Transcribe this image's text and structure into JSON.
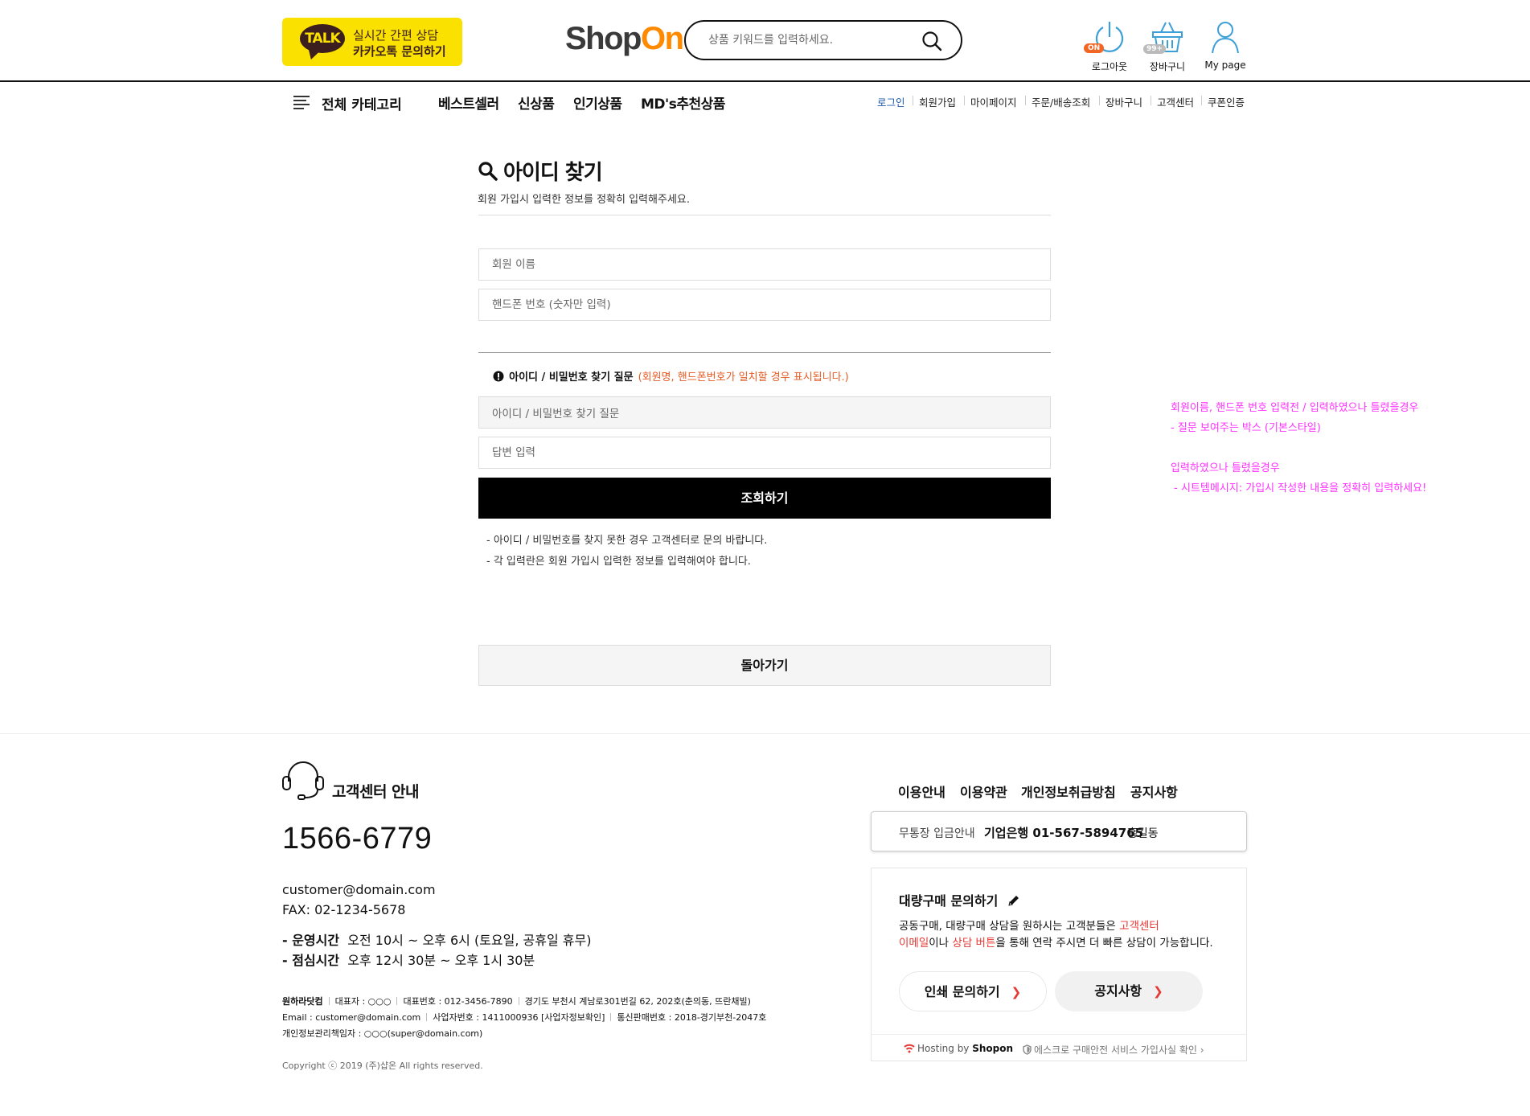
{
  "header": {
    "kakao": {
      "badge": "TALK",
      "line1": "실시간 간편 상담",
      "line2": "카카오톡 문의하기"
    },
    "logo": {
      "part1": "Shop",
      "part2": "On"
    },
    "search": {
      "placeholder": "상품 키워드를 입력하세요."
    },
    "icons": [
      {
        "label": "로그아웃",
        "badge": "ON"
      },
      {
        "label": "장바구니",
        "badge": "99+"
      },
      {
        "label": "My page"
      }
    ]
  },
  "nav": {
    "all_categories": "전체 카테고리",
    "main": [
      "베스트셀러",
      "신상품",
      "인기상품",
      "MD's추천상품"
    ],
    "util": [
      "로그인",
      "회원가입",
      "마이페이지",
      "주문/배송조회",
      "장바구니",
      "고객센터",
      "쿠폰인증"
    ]
  },
  "main": {
    "title": "아이디 찾기",
    "subtitle": "회원 가입시 입력한 정보를 정확히 입력해주세요.",
    "name_placeholder": "회원 이름",
    "phone_placeholder": "핸드폰 번호 (숫자만 입력)",
    "question_label": "아이디 / 비밀번호 찾기 질문",
    "question_hint": "(회원명, 핸드폰번호가 일치할 경우 표시됩니다.)",
    "question_value": "아이디 / 비밀번호 찾기 질문",
    "answer_placeholder": "답변 입력",
    "submit_label": "조회하기",
    "notes": [
      "- 아이디 / 비밀번호를 찾지 못한 경우 고객센터로 문의 바랍니다.",
      "- 각 입력란은 회원 가입시 입력한 정보를 입력해여야 합니다."
    ],
    "back_label": "돌아가기"
  },
  "memo": {
    "lines": [
      "회원이름, 핸드폰 번호 입력전 / 입력하였으나 틀렸을경우",
      "- 질문 보여주는 박스 (기본스타일)",
      "입력하였으나 틀렸을경우",
      " - 시트템메시지: 가입시 작성한 내용을 정확히 입력하세요!"
    ],
    "color": "#ff33ff"
  },
  "footer": {
    "cs_title": "고객센터 안내",
    "phone": "1566-6779",
    "email": "customer@domain.com",
    "fax": "FAX: 02-1234-5678",
    "hours_label": "- 운영시간",
    "hours": "오전 10시 ~ 오후 6시 (토요일, 공휴일 휴무)",
    "lunch_label": "- 점심시간",
    "lunch": "오후 12시 30분 ~ 오후 1시 30분",
    "company": {
      "row1": [
        "원하라닷컴",
        "대표자 : ○○○",
        "대표번호 : 012-3456-7890",
        "경기도 부천시 계남로301번길 62, 202호(춘의동, 뜨란채빌)"
      ],
      "row2": [
        "Email : customer@domain.com",
        "사업자번호 : 1411000936 [사업자정보확인]",
        "통신판매번호 : 2018-경기부천-2047호"
      ],
      "row3": "개인정보관리책임자 : ○○○(super@domain.com)"
    },
    "copyright": "Copyright ⓒ 2019 (주)샵온 All rights reserved.",
    "links": [
      "이용안내",
      "이용약관",
      "개인정보취급방침",
      "공지사항"
    ],
    "bank": {
      "label": "무통장 입금안내",
      "account": "기업은행 01-567-5894765",
      "holder": "홍길동"
    },
    "bulk": {
      "title": "대량구매 문의하기",
      "text1a": "공동구매, 대량구매 상담을 원하시는 고객분들은 ",
      "text1b": "고객센터",
      "text2a": "이메일",
      "text2b": "이나 ",
      "text2c": "상담 버튼",
      "text2d": "을 통해 연락 주시면 더 빠른 상담이 가능합니다.",
      "btn1": "인쇄 문의하기",
      "btn2": "공지사항",
      "hosting_pre": "Hosting by ",
      "hosting_brand": "Shopon",
      "escrow": "에스크로 구매안전 서비스 가입사실 확인"
    }
  }
}
